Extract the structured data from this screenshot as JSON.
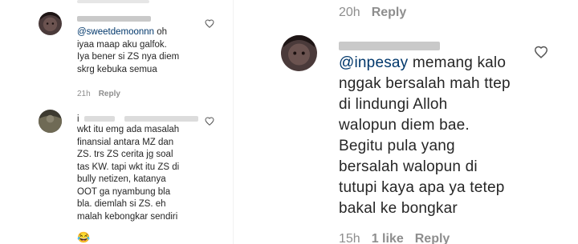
{
  "left": {
    "comments": [
      {
        "mention": "@sweetdemoonnn",
        "text_after_mention": " oh\niyaa maap aku galfok.\nIya bener si ZS nya diem\nskrg kebuka semua",
        "time": "21h",
        "reply": "Reply",
        "heart_icon": "heart-icon"
      },
      {
        "username_prefix": "i",
        "text": "wkt itu emg ada masalah\nfinansial antara MZ dan\nZS. trs ZS cerita jg soal\ntas KW. tapi wkt itu ZS di\nbully netizen, katanya\nOOT ga nyambung bla\nbla. diemlah si ZS. eh\nmalah kebongkar sendiri",
        "emoji": "😂",
        "heart_icon": "heart-icon"
      }
    ]
  },
  "right": {
    "top_meta": {
      "time": "20h",
      "reply": "Reply"
    },
    "comment": {
      "mention": "@inpesay",
      "text_after_mention": " memang kalo\nnggak bersalah mah ttep\ndi lindungi Alloh\nwalopun diem bae.\nBegitu pula yang\nbersalah walopun di\ntutupi kaya apa ya tetep\nbakal ke bongkar",
      "time": "15h",
      "likes": "1 like",
      "reply": "Reply",
      "heart_icon": "heart-icon"
    }
  }
}
